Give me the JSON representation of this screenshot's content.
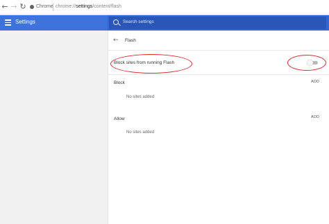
{
  "browser": {
    "back_icon": "arrow-left-icon",
    "forward_icon": "arrow-right-icon",
    "reload_icon": "reload-icon",
    "secure_icon": "info-dot-icon",
    "chip_label": "Chrome",
    "url_host": "chrome://",
    "url_bold": "settings",
    "url_path": "/content/flash"
  },
  "header": {
    "menu_icon": "hamburger-icon",
    "title": "Settings",
    "search_placeholder": "Search settings",
    "search_icon": "search-icon"
  },
  "page": {
    "back_icon": "back-arrow-icon",
    "title": "Flash",
    "toggle_label": "Block sites from running Flash",
    "toggle_on": false
  },
  "sections": {
    "block": {
      "title": "Block",
      "add_label": "ADD",
      "empty_text": "No sites added"
    },
    "allow": {
      "title": "Allow",
      "add_label": "ADD",
      "empty_text": "No sites added"
    }
  },
  "colors": {
    "header_blue": "#3367d6",
    "annotation_red": "#e0242c"
  }
}
